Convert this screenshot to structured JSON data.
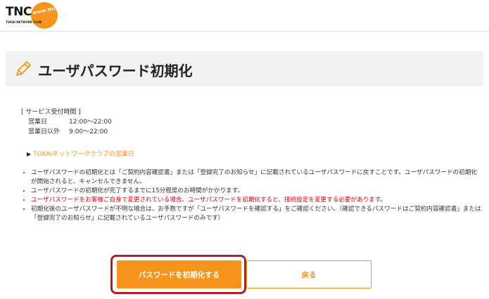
{
  "header": {
    "logo_text": "TNC",
    "logo_sub": "TOKAI NETWORK CLUB",
    "logo_url": "www.tnc.ne.jp"
  },
  "page": {
    "title": "ユーザパスワード初期化",
    "title_icon": "pencil-icon"
  },
  "service_hours": {
    "heading": "[ サービス受付時間 ]",
    "rows": [
      {
        "label": "営業日",
        "value": "12:00〜22:00"
      },
      {
        "label": "営業日以外",
        "value": "9:00〜22:00"
      }
    ]
  },
  "club_link": {
    "arrow": "▶",
    "label": "TOKAIネットワーククラブの営業日"
  },
  "notes": [
    "ユーザパスワードの初期化とは「ご契約内容確認書」または「登録完了のお知らせ」に記載されているユーザパスワードに戻すことです。ユーザパスワードの初期化が開始されると、キャンセルできません。",
    "ユーザパスワードの初期化が完了するまでに15分程度のお時間がかかります。",
    "ユーザパスワードをお客様ご自身で変更されている場合、ユーザパスワードを初期化すると、接続設定を変更する必要があります。",
    "初期化後のユーザパスワードが不明な場合は、お手数ですが「ユーザパスワードを確認する」をご確認ください。（確認できるパスワードはご契約内容確認書」または「登録完了のお知らせ」に記載されているユーザパスワードのみです）"
  ],
  "actions": {
    "reset_label": "パスワードを初期化する",
    "back_label": "戻る"
  },
  "colors": {
    "accent": "#f7941d",
    "warning": "#e60012",
    "focus_ring": "#b01f2a"
  }
}
